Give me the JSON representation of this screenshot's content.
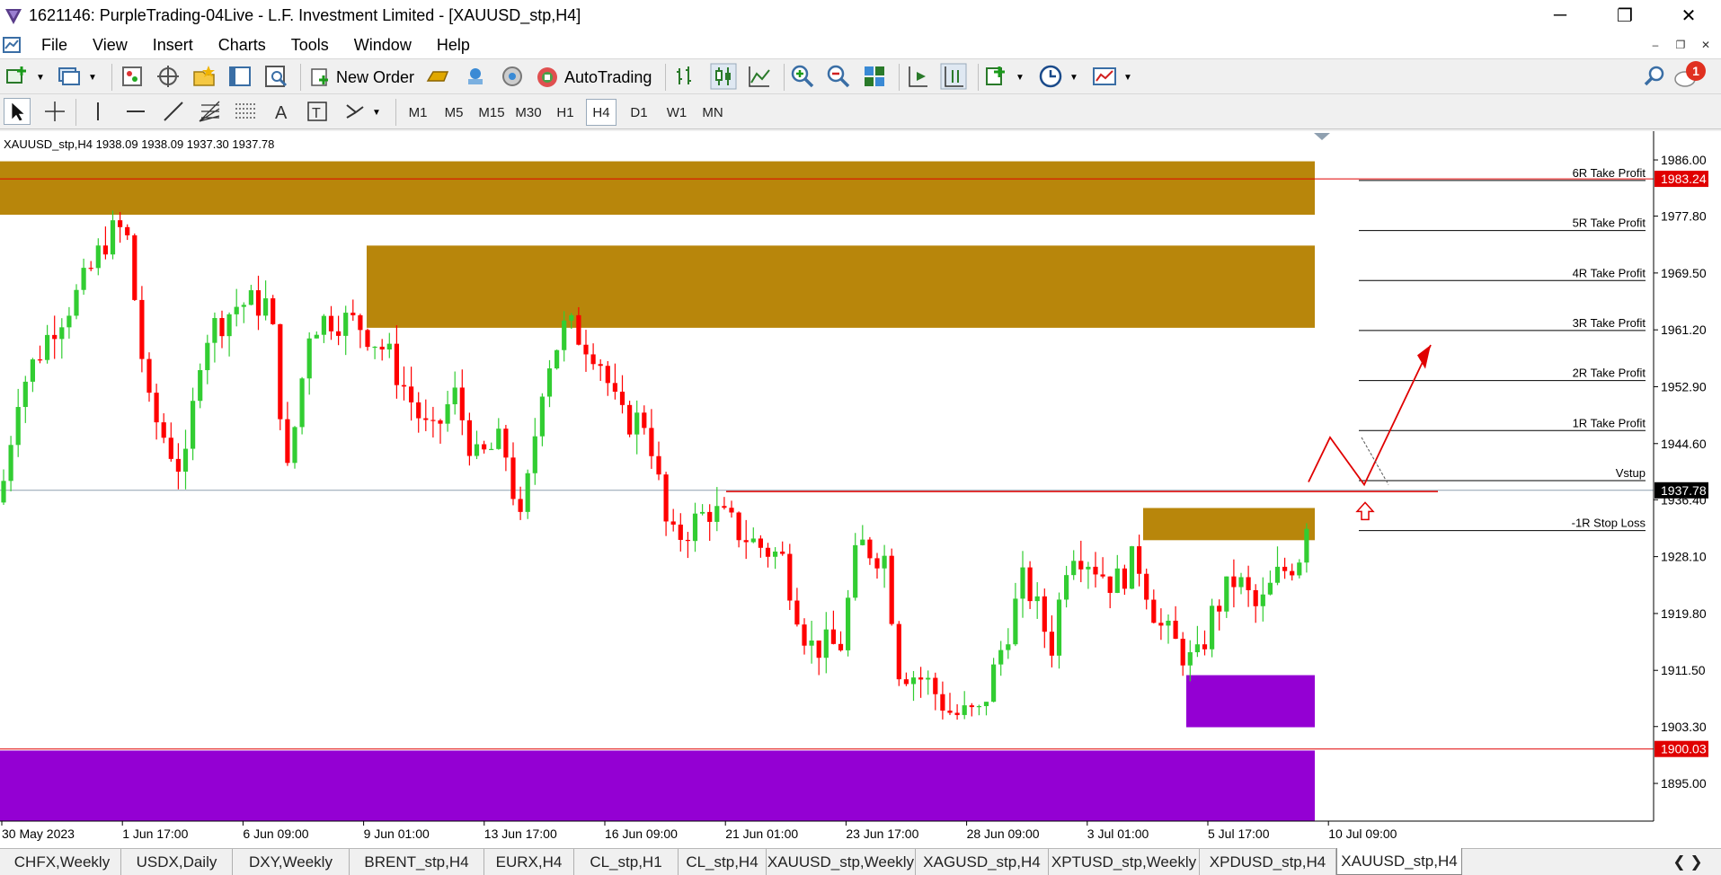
{
  "window": {
    "title": "1621146: PurpleTrading-04Live - L.F. Investment Limited - [XAUUSD_stp,H4]",
    "minimize": "─",
    "maximize": "❐",
    "close": "✕"
  },
  "menu": [
    "File",
    "View",
    "Insert",
    "Charts",
    "Tools",
    "Window",
    "Help"
  ],
  "toolbar": {
    "new_order": "New Order",
    "autotrading": "AutoTrading",
    "notification_count": "1"
  },
  "timeframes": [
    "M1",
    "M5",
    "M15",
    "M30",
    "H1",
    "H4",
    "D1",
    "W1",
    "MN"
  ],
  "active_timeframe": "H4",
  "chart_header": "XAUUSD_stp,H4  1938.09 1938.09 1937.30 1937.78",
  "chart_data": {
    "type": "candlestick",
    "symbol": "XAUUSD_stp",
    "timeframe": "H4",
    "ohlc": {
      "open": 1938.09,
      "high": 1938.09,
      "low": 1937.3,
      "close": 1937.78
    },
    "ylim": [
      1889.5,
      1990.2
    ],
    "price_ticks": [
      "1986.00",
      "1977.80",
      "1969.50",
      "1961.20",
      "1952.90",
      "1944.60",
      "1936.40",
      "1928.10",
      "1919.80",
      "1911.50",
      "1903.30",
      "1895.00"
    ],
    "price_tick_values": [
      1986.0,
      1977.8,
      1969.5,
      1961.2,
      1952.9,
      1944.6,
      1936.4,
      1928.1,
      1919.8,
      1911.5,
      1903.3,
      1895.0
    ],
    "time_labels": [
      "30 May 2023",
      "1 Jun 17:00",
      "6 Jun 09:00",
      "9 Jun 01:00",
      "13 Jun 17:00",
      "16 Jun 09:00",
      "21 Jun 01:00",
      "23 Jun 17:00",
      "28 Jun 09:00",
      "3 Jul 01:00",
      "5 Jul 17:00",
      "10 Jul 09:00"
    ],
    "current_price_label": "1937.78",
    "current_price": 1937.78,
    "hlines": [
      {
        "label": "1983.24",
        "value": 1983.24,
        "color": "#e00000"
      },
      {
        "label": "1900.03",
        "value": 1900.03,
        "color": "#e00000"
      }
    ],
    "levels": [
      {
        "label": "6R Take Profit",
        "value": 1983.0
      },
      {
        "label": "5R Take Profit",
        "value": 1975.7
      },
      {
        "label": "4R Take Profit",
        "value": 1968.4
      },
      {
        "label": "3R Take Profit",
        "value": 1961.1
      },
      {
        "label": "2R Take Profit",
        "value": 1953.8
      },
      {
        "label": "1R Take Profit",
        "value": 1946.5
      },
      {
        "label": "Vstup",
        "value": 1939.2
      },
      {
        "label": "-1R Stop Loss",
        "value": 1931.9
      }
    ],
    "zones": [
      {
        "name": "supply-zone-top",
        "from": 1978.0,
        "to": 1985.8,
        "color": "#b8860b"
      },
      {
        "name": "supply-zone-mid",
        "from": 1961.5,
        "to": 1973.5,
        "color": "#b8860b"
      },
      {
        "name": "demand-zone-small",
        "from": 1930.5,
        "to": 1935.2,
        "color": "#b8860b"
      },
      {
        "name": "demand-zone-purple",
        "from": 1903.2,
        "to": 1910.8,
        "color": "#9400d3"
      },
      {
        "name": "demand-zone-purple-bottom",
        "from": 1889.5,
        "to": 1899.8,
        "color": "#9400d3"
      }
    ],
    "colors": {
      "bull": "#32cd32",
      "bear": "#ff0000",
      "grid": "#dddddd"
    }
  },
  "symbol_tabs": [
    "CHFX,Weekly",
    "USDX,Daily",
    "DXY,Weekly",
    "BRENT_stp,H4",
    "EURX,H4",
    "CL_stp,H1",
    "CL_stp,H4",
    "XAUUSD_stp,Weekly",
    "XAGUSD_stp,H4",
    "XPTUSD_stp,Weekly",
    "XPDUSD_stp,H4",
    "XAUUSD_stp,H4"
  ],
  "active_tab": "XAUUSD_stp,H4"
}
